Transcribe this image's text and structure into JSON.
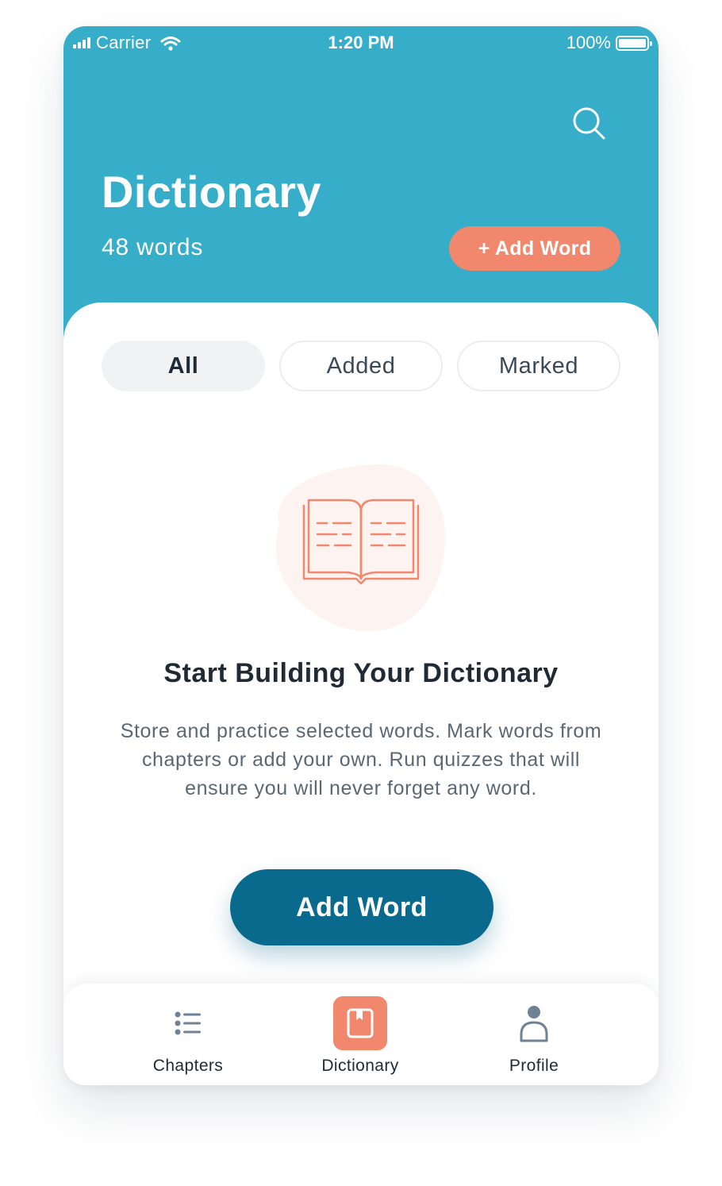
{
  "status_bar": {
    "carrier": "Carrier",
    "time": "1:20 PM",
    "battery": "100%"
  },
  "header": {
    "title": "Dictionary",
    "word_count": "48 words",
    "add_button": "+ Add Word",
    "search_icon": "search-icon"
  },
  "filters": [
    {
      "label": "All",
      "selected": true
    },
    {
      "label": "Added",
      "selected": false
    },
    {
      "label": "Marked",
      "selected": false
    }
  ],
  "empty_state": {
    "icon": "open-book-icon",
    "title": "Start Building Your Dictionary",
    "description": "Store and practice selected words. Mark words from chapters or add your own. Run quizzes that will ensure you will never forget any word.",
    "button": "Add Word"
  },
  "tabbar": {
    "items": [
      {
        "label": "Chapters",
        "icon": "list-icon",
        "active": false
      },
      {
        "label": "Dictionary",
        "icon": "book-icon",
        "active": true
      },
      {
        "label": "Profile",
        "icon": "person-icon",
        "active": false
      }
    ]
  },
  "colors": {
    "header_bg": "#36adc9",
    "accent": "#f1876d",
    "primary_button": "#0a6a8e",
    "text_dark": "#1f2a35",
    "text_muted": "#5b6772",
    "pill_selected_bg": "#f0f2f3"
  }
}
